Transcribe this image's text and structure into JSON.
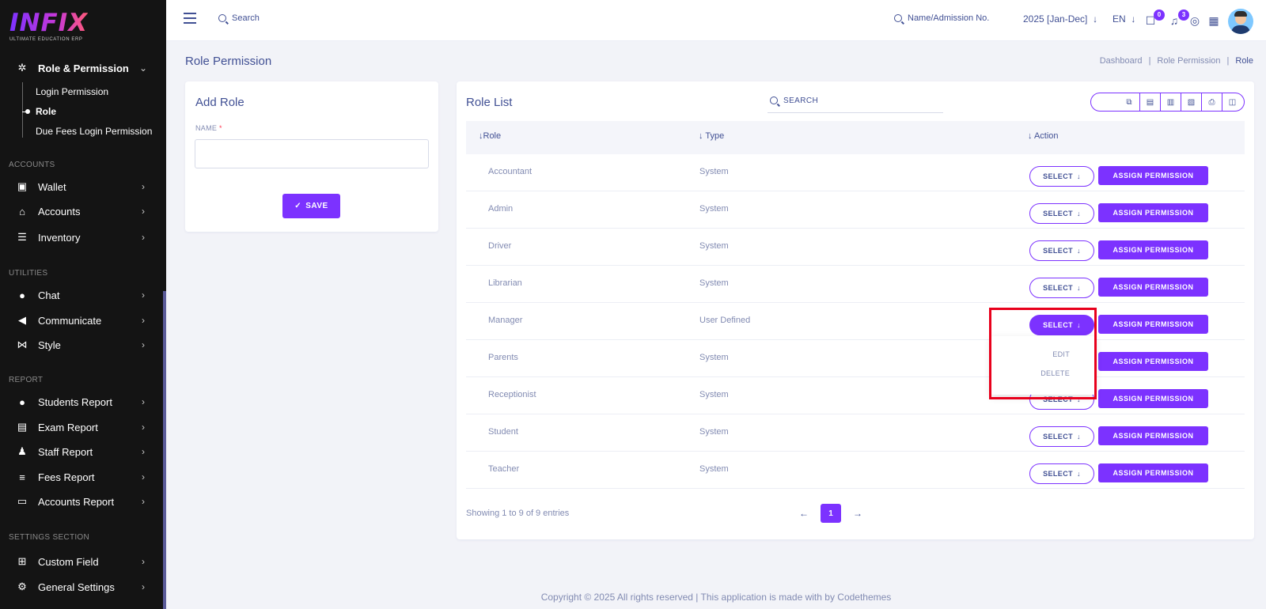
{
  "app": {
    "brand": "INFIX",
    "tagline": "ULTIMATE EDUCATION ERP"
  },
  "sidebar": {
    "active_group": {
      "label": "Role & Permission",
      "icon": "palette-icon"
    },
    "sub_items": [
      {
        "label": "Login Permission",
        "active": false
      },
      {
        "label": "Role",
        "active": true
      },
      {
        "label": "Due Fees Login Permission",
        "active": false
      }
    ],
    "sections": [
      {
        "title": "ACCOUNTS",
        "items": [
          {
            "label": "Wallet",
            "icon": "wallet-icon"
          },
          {
            "label": "Accounts",
            "icon": "bank-icon"
          },
          {
            "label": "Inventory",
            "icon": "inventory-icon"
          }
        ]
      },
      {
        "title": "UTILITIES",
        "items": [
          {
            "label": "Chat",
            "icon": "chat-icon"
          },
          {
            "label": "Communicate",
            "icon": "megaphone-icon"
          },
          {
            "label": "Style",
            "icon": "style-icon"
          }
        ]
      },
      {
        "title": "REPORT",
        "items": [
          {
            "label": "Students Report",
            "icon": "users-icon"
          },
          {
            "label": "Exam Report",
            "icon": "file-icon"
          },
          {
            "label": "Staff Report",
            "icon": "user-tie-icon"
          },
          {
            "label": "Fees Report",
            "icon": "list-icon"
          },
          {
            "label": "Accounts Report",
            "icon": "money-icon"
          }
        ]
      },
      {
        "title": "SETTINGS SECTION",
        "items": [
          {
            "label": "Custom Field",
            "icon": "custom-field-icon"
          },
          {
            "label": "General Settings",
            "icon": "settings-icon"
          }
        ]
      }
    ]
  },
  "header": {
    "search_placeholder": "Search",
    "admission_search_placeholder": "Name/Admission No.",
    "session": "2025 [Jan-Dec]",
    "language": "EN",
    "message_count": "0",
    "notification_count": "3"
  },
  "page": {
    "title": "Role Permission",
    "breadcrumb": [
      "Dashboard",
      "Role Permission",
      "Role"
    ]
  },
  "add_role": {
    "title": "Add Role",
    "name_label": "NAME",
    "required_mark": "*",
    "name_value": "",
    "save_label": "SAVE"
  },
  "role_list": {
    "title": "Role List",
    "search_placeholder": "SEARCH",
    "columns": [
      "Role",
      "Type",
      "Action"
    ],
    "select_label": "SELECT",
    "assign_label": "ASSIGN PERMISSION",
    "rows": [
      {
        "role": "Accountant",
        "type": "System"
      },
      {
        "role": "Admin",
        "type": "System"
      },
      {
        "role": "Driver",
        "type": "System"
      },
      {
        "role": "Librarian",
        "type": "System"
      },
      {
        "role": "Manager",
        "type": "User Defined"
      },
      {
        "role": "Parents",
        "type": "System"
      },
      {
        "role": "Receptionist",
        "type": "System"
      },
      {
        "role": "Student",
        "type": "System"
      },
      {
        "role": "Teacher",
        "type": "System"
      }
    ],
    "dropdown": {
      "row_index": 4,
      "options": [
        "EDIT",
        "DELETE"
      ]
    },
    "showing": "Showing 1 to 9 of 9 entries",
    "current_page": "1"
  },
  "footer": {
    "text": "Copyright © 2025 All rights reserved | This application is made with by Codethemes"
  },
  "colors": {
    "accent": "#7c32ff",
    "sidebar_bg": "#141414",
    "text_primary": "#415094",
    "text_muted": "#828bb2",
    "highlight": "#e8001c"
  }
}
